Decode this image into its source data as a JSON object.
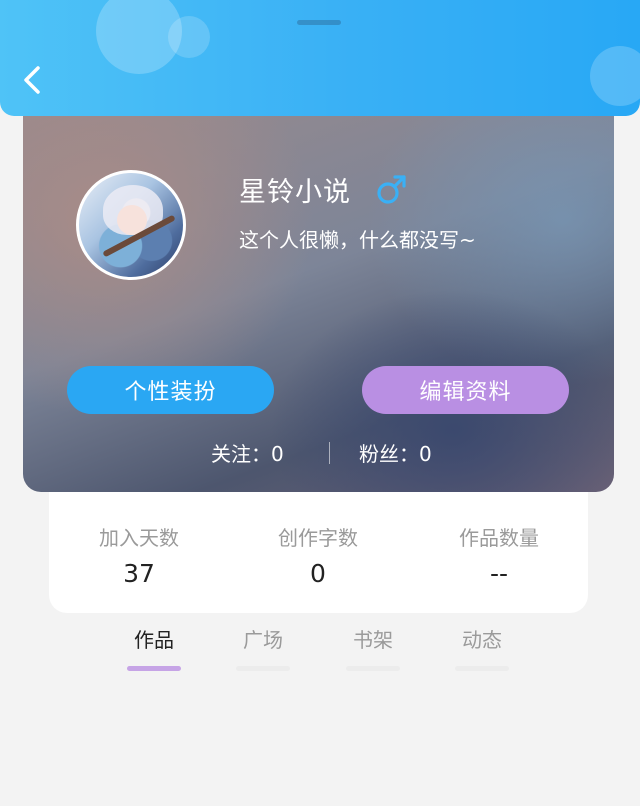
{
  "header": {
    "back_icon": "chevron-left-icon"
  },
  "profile": {
    "username": "星铃小说",
    "gender_icon": "male-symbol-icon",
    "gender_color": "#3ab0f5",
    "bio": "这个人很懒，什么都没写~",
    "decorate_label": "个性装扮",
    "edit_label": "编辑资料",
    "following_label": "关注：0",
    "fans_label": "粉丝：0"
  },
  "stats": [
    {
      "label": "加入天数",
      "value": "37"
    },
    {
      "label": "创作字数",
      "value": "0"
    },
    {
      "label": "作品数量",
      "value": "--"
    }
  ],
  "tabs": [
    {
      "label": "作品",
      "active": true
    },
    {
      "label": "广场",
      "active": false
    },
    {
      "label": "书架",
      "active": false
    },
    {
      "label": "动态",
      "active": false
    }
  ],
  "colors": {
    "header_blue": "#39b0f5",
    "decorate_button": "#2aa7f3",
    "edit_button": "#b98fe3",
    "active_tab_underline": "#c6a4e6"
  }
}
